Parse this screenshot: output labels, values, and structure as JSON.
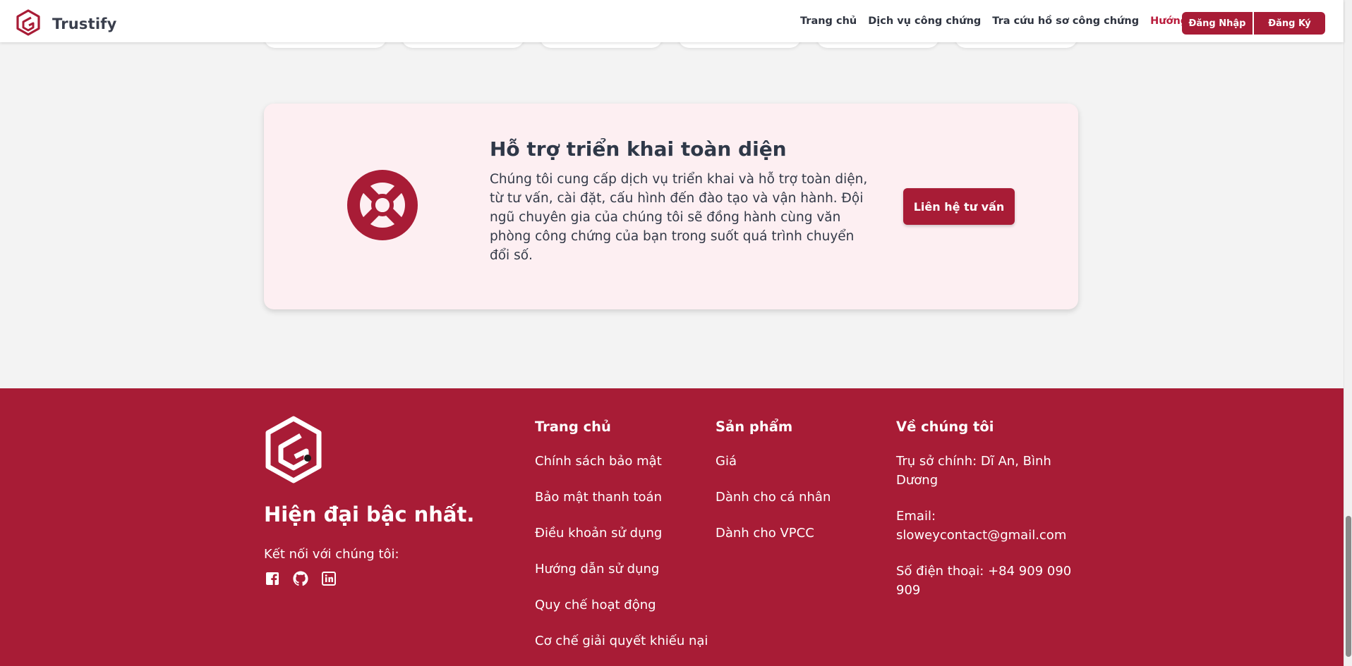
{
  "header": {
    "brand_name": "Trustify",
    "nav": [
      "Trang chủ",
      "Dịch vụ công chứng",
      "Tra cứu hồ sơ công chứng",
      "Hướng dẫn"
    ],
    "active_nav": "Hướng dẫn",
    "login_label": "Đăng Nhập",
    "register_label": "Đăng Ký"
  },
  "support": {
    "title": "Hỗ trợ triển khai toàn diện",
    "description": "Chúng tôi cung cấp dịch vụ triển khai và hỗ trợ toàn diện, từ tư vấn, cài đặt, cấu hình đến đào tạo và vận hành. Đội ngũ chuyên gia của chúng tôi sẽ đồng hành cùng văn phòng công chứng của bạn trong suốt quá trình chuyển đổi số.",
    "button_label": "Liên hệ tư vấn",
    "icon": "lifebuoy-icon"
  },
  "footer": {
    "tagline": "Hiện đại bậc nhất.",
    "connect_label": "Kết nối với chúng tôi:",
    "social": [
      "facebook-icon",
      "github-icon",
      "linkedin-icon"
    ],
    "col_home": {
      "title": "Trang chủ",
      "links": [
        "Chính sách bảo mật",
        "Bảo mật thanh toán",
        "Điều khoản sử dụng",
        "Hướng dẫn sử dụng",
        "Quy chế hoạt động",
        "Cơ chế giải quyết khiếu nại"
      ]
    },
    "col_products": {
      "title": "Sản phẩm",
      "links": [
        "Giá",
        "Dành cho cá nhân",
        "Dành cho VPCC"
      ]
    },
    "col_about": {
      "title": "Về chúng tôi",
      "address": "Trụ sở chính: Dĩ An, Bình Dương",
      "email": "Email: sloweycontact@gmail.com",
      "phone": "Số điện thoại: +84 909 090 909"
    }
  },
  "colors": {
    "brand": "#a81c36",
    "active_link": "#b91c3c",
    "support_bg": "#fdeff2",
    "page_bg": "#f3f3f3"
  }
}
